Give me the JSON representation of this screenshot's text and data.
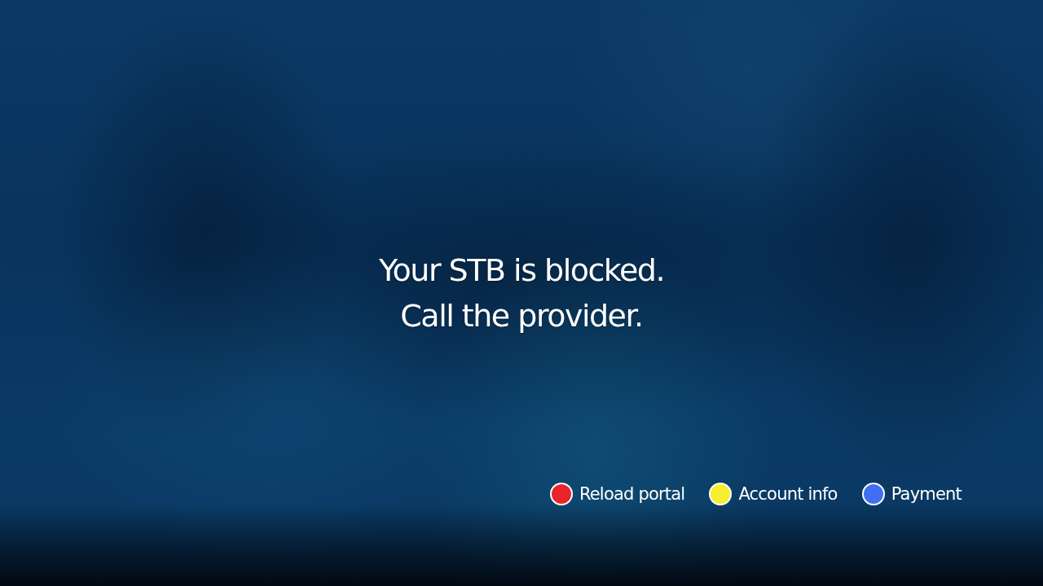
{
  "message": {
    "lines": [
      "Your STB is blocked.",
      "Call the provider."
    ]
  },
  "key_hints": [
    {
      "label": "Reload portal",
      "color": "#e8262a"
    },
    {
      "label": "Account info",
      "color": "#f6ee2e"
    },
    {
      "label": "Payment",
      "color": "#416ef2"
    }
  ]
}
